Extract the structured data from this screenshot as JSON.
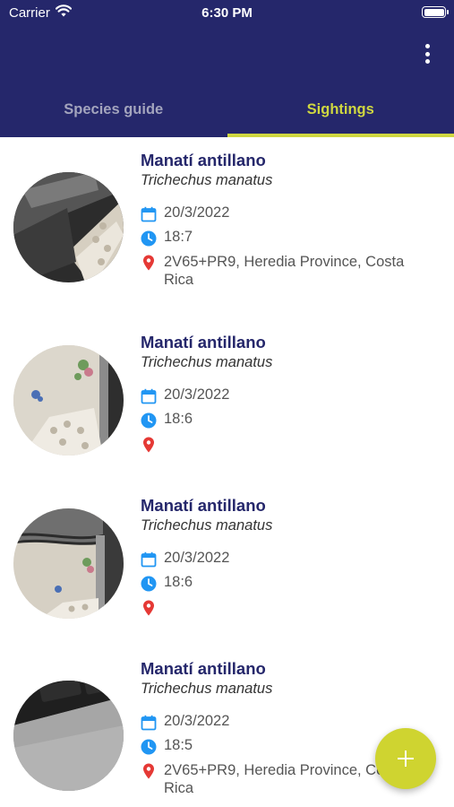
{
  "status_bar": {
    "carrier": "Carrier",
    "time": "6:30 PM"
  },
  "app_bar": {
    "menu_icon": "more-vert-icon"
  },
  "tabs": [
    {
      "label": "Species guide",
      "selected": false
    },
    {
      "label": "Sightings",
      "selected": true
    }
  ],
  "sightings": [
    {
      "common_name": "Manatí antillano",
      "scientific_name": "Trichechus manatus",
      "date": "20/3/2022",
      "time": "18:7",
      "location": "2V65+PR9, Heredia Province, Costa Rica"
    },
    {
      "common_name": "Manatí antillano",
      "scientific_name": "Trichechus manatus",
      "date": "20/3/2022",
      "time": "18:6",
      "location": ""
    },
    {
      "common_name": "Manatí antillano",
      "scientific_name": "Trichechus manatus",
      "date": "20/3/2022",
      "time": "18:6",
      "location": ""
    },
    {
      "common_name": "Manatí antillano",
      "scientific_name": "Trichechus manatus",
      "date": "20/3/2022",
      "time": "18:5",
      "location": "2V65+PR9, Heredia Province, Costa Rica"
    }
  ],
  "icons": {
    "date": "calendar-icon",
    "time": "clock-icon",
    "location": "location-pin-icon",
    "fab": "add-icon"
  },
  "colors": {
    "primary": "#25276b",
    "accent": "#cfd740",
    "fab": "#cfd430",
    "calendar": "#2196f3",
    "pin": "#e53935"
  }
}
